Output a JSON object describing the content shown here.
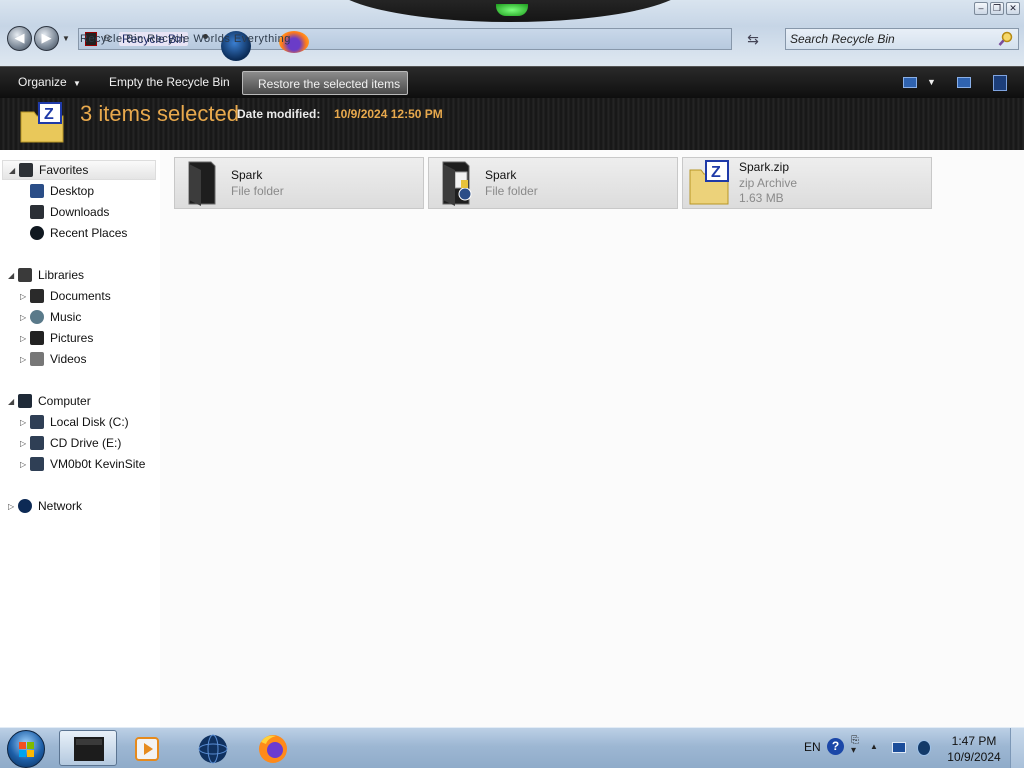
{
  "window": {
    "address": {
      "location": "Recycle Bin",
      "ghost_text": "Recycle Bin          Recycle Worlds  Everything"
    },
    "search": {
      "placeholder": "Search Recycle Bin"
    }
  },
  "commandbar": {
    "organize_label": "Organize",
    "empty_label": "Empty the Recycle Bin",
    "restore_label": "Restore the selected items"
  },
  "details": {
    "selection_count": "3 items selected",
    "date_label": "Date modified:",
    "date_value": "10/9/2024 12:50 PM"
  },
  "navpane": {
    "favorites": {
      "label": "Favorites",
      "items": [
        "Desktop",
        "Downloads",
        "Recent Places"
      ]
    },
    "libraries": {
      "label": "Libraries",
      "items": [
        "Documents",
        "Music",
        "Pictures",
        "Videos"
      ]
    },
    "computer": {
      "label": "Computer",
      "items": [
        "Local Disk (C:)",
        "CD Drive (E:)",
        "VM0b0t KevinSite"
      ]
    },
    "network": {
      "label": "Network"
    }
  },
  "items": [
    {
      "name": "Spark",
      "type": "File folder",
      "size": ""
    },
    {
      "name": "Spark",
      "type": "File folder",
      "size": ""
    },
    {
      "name": "Spark.zip",
      "type": "zip Archive",
      "size": "1.63 MB"
    }
  ],
  "taskbar": {
    "language": "EN",
    "clock_time": "1:47 PM",
    "clock_date": "10/9/2024"
  },
  "colors": {
    "accent_orange": "#e8a94d",
    "command_bar": "#1a1a1a",
    "taskbar": "#9db7d3"
  }
}
